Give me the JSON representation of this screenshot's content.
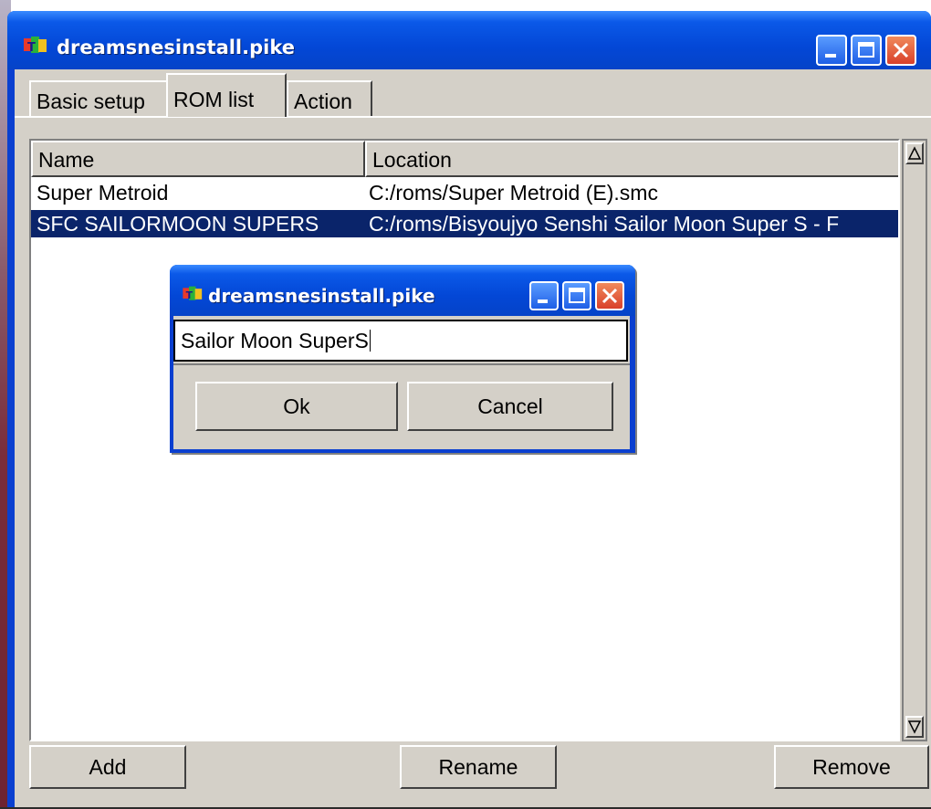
{
  "window": {
    "title": "dreamsnesinstall.pike",
    "controls": {
      "minimize": "minimize-icon",
      "maximize": "maximize-icon",
      "close": "close-icon"
    }
  },
  "tabs": [
    {
      "label": "Basic setup",
      "active": false
    },
    {
      "label": "ROM list",
      "active": true
    },
    {
      "label": "Action",
      "active": false
    }
  ],
  "list": {
    "columns": [
      "Name",
      "Location"
    ],
    "rows": [
      {
        "name": "Super Metroid",
        "location": "C:/roms/Super Metroid (E).smc",
        "selected": false
      },
      {
        "name": "SFC SAILORMOON SUPERS",
        "location": "C:/roms/Bisyoujyo Senshi Sailor Moon Super S - F",
        "selected": true
      }
    ]
  },
  "buttons": {
    "add": "Add",
    "rename": "Rename",
    "remove": "Remove"
  },
  "dialog": {
    "title": "dreamsnesinstall.pike",
    "input_value": "Sailor Moon SuperS",
    "ok": "Ok",
    "cancel": "Cancel"
  },
  "colors": {
    "titlebar": "#0347d6",
    "selection": "#0a246a",
    "face": "#d4d0c8",
    "close_button": "#d9402a"
  }
}
